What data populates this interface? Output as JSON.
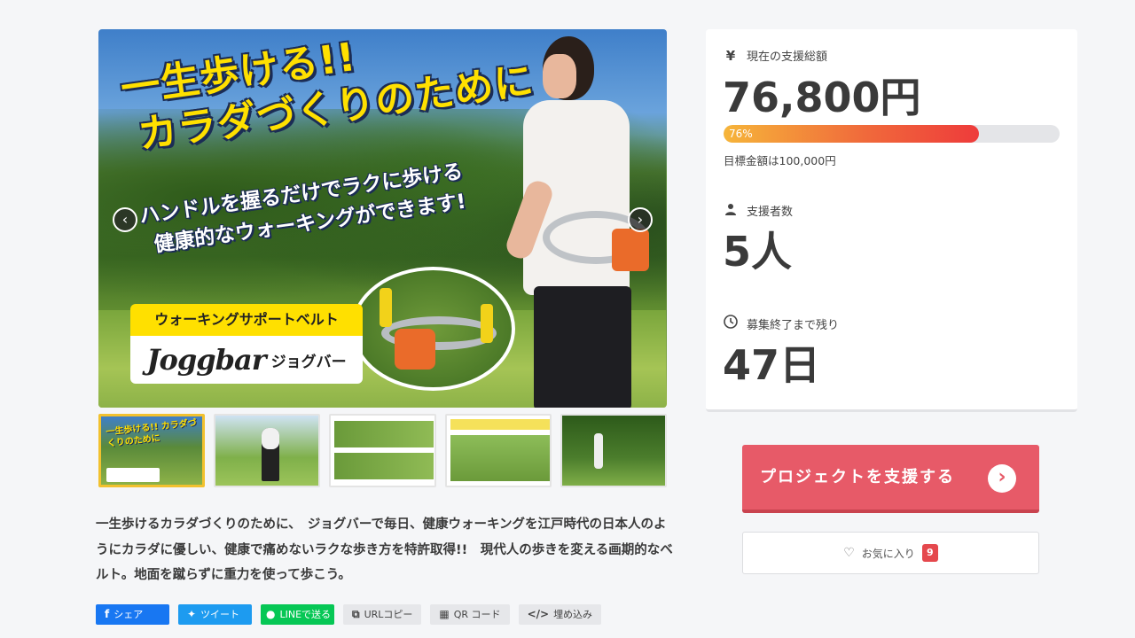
{
  "hero": {
    "title_line1": "一生歩ける!!",
    "title_line2": "カラダづくりのために",
    "sub_line1": "ハンドルを握るだけでラクに歩ける",
    "sub_line2": "健康的なウォーキングができます!",
    "badge_label": "ウォーキングサポートベルト",
    "brand": "Joggbar",
    "brand_kana": "ジョグバー",
    "prev_icon": "‹",
    "next_icon": "›"
  },
  "thumbnails": [
    {
      "name": "thumb-1",
      "title": "一生歩ける!! カラダづくりのために",
      "active": true
    },
    {
      "name": "thumb-2",
      "active": false
    },
    {
      "name": "thumb-3",
      "active": false
    },
    {
      "name": "thumb-4",
      "active": false
    },
    {
      "name": "thumb-5",
      "active": false
    }
  ],
  "description": "一生歩けるカラダづくりのために、　ジョグバーで毎日、健康ウォーキングを江戸時代の日本人のようにカラダに優しい、健康で痛めないラクな歩き方を特許取得!!　現代人の歩きを変える画期的なベルト。地面を蹴らずに重力を使って歩こう。",
  "share": {
    "facebook": "シェア",
    "twitter": "ツイート",
    "line": "LINEで送る",
    "url_copy": "URLコピー",
    "qr": "QR コード",
    "embed": "埋め込み"
  },
  "stats": {
    "total_label": "現在の支援総額",
    "total_icon": "¥",
    "total_value": "76,800円",
    "progress_percent": 76,
    "progress_label": "76%",
    "goal_text": "目標金額は100,000円",
    "supporters_label": "支援者数",
    "supporters_value": "5人",
    "remaining_label": "募集終了まで残り",
    "remaining_value": "47日"
  },
  "actions": {
    "support_label": "プロジェクトを支援する",
    "favorite_label": "お気に入り",
    "favorite_count": "9"
  },
  "colors": {
    "support_button": "#e75a68",
    "progress_start": "#f6b53a",
    "progress_end": "#ee3b3b",
    "favorite_badge": "#e5484d"
  }
}
